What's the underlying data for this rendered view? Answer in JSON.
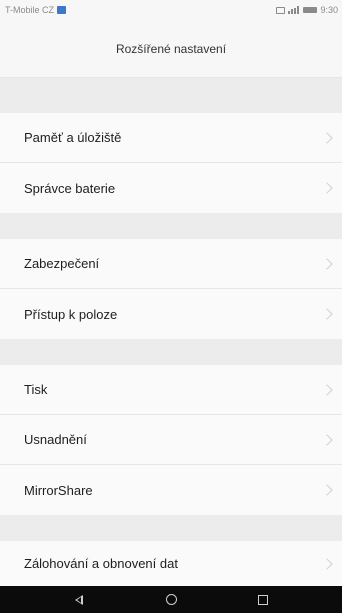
{
  "status_bar": {
    "carrier": "T-Mobile CZ",
    "time": "9:30",
    "icons": [
      "sim-icon",
      "message-icon",
      "signal-icon",
      "battery-icon"
    ]
  },
  "header": {
    "title": "Rozšířené nastavení"
  },
  "groups": [
    {
      "items": [
        {
          "label": "Paměť a úložiště"
        },
        {
          "label": "Správce baterie"
        }
      ]
    },
    {
      "items": [
        {
          "label": "Zabezpečení"
        },
        {
          "label": "Přístup k poloze"
        }
      ]
    },
    {
      "items": [
        {
          "label": "Tisk"
        },
        {
          "label": "Usnadnění"
        },
        {
          "label": "MirrorShare"
        }
      ]
    },
    {
      "items": [
        {
          "label": "Zálohování a obnovení dat"
        }
      ]
    }
  ],
  "nav_bar": {
    "buttons": [
      "back-icon",
      "home-icon",
      "recent-apps-icon"
    ]
  },
  "colors": {
    "background": "#f4f4f4",
    "group_background": "#fafafa",
    "separator": "#ececec",
    "nav_bar": "#0b0b0b",
    "sim_accent": "#3a78c9"
  }
}
